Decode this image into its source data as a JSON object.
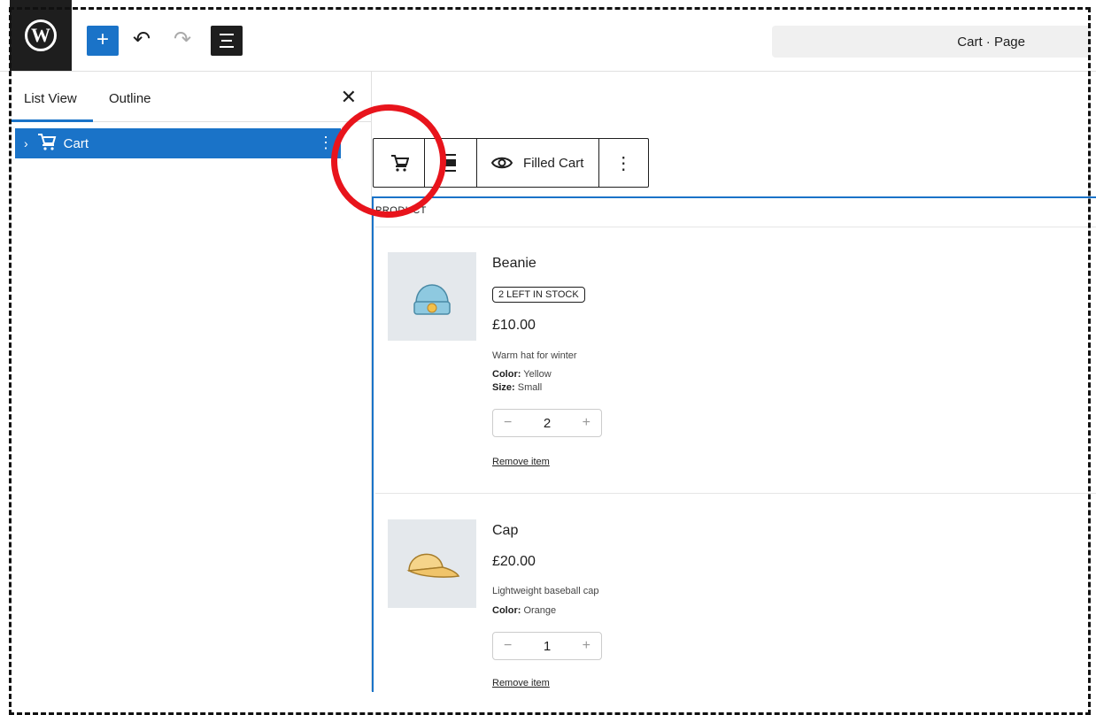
{
  "header": {
    "logo_letter": "W",
    "add_symbol": "+",
    "undo_symbol": "↶",
    "redo_symbol": "↷",
    "command_bar_text": "Cart · Page"
  },
  "sidebar": {
    "tabs": [
      {
        "label": "List View"
      },
      {
        "label": "Outline"
      }
    ],
    "close_symbol": "✕",
    "items": [
      {
        "label": "Cart",
        "chevron": "›",
        "icon": "cart-icon",
        "more": "⋮"
      }
    ]
  },
  "block_toolbar": {
    "view_label": "Filled Cart",
    "more": "⋮"
  },
  "cart": {
    "products_heading": "PRODUCT",
    "items": [
      {
        "name": "Beanie",
        "badge": "2 LEFT IN STOCK",
        "price": "£10.00",
        "description": "Warm hat for winter",
        "attrs": [
          {
            "key": "Color:",
            "value": " Yellow"
          },
          {
            "key": "Size:",
            "value": " Small"
          }
        ],
        "minus": "−",
        "quantity": "2",
        "plus": "+",
        "remove_label": "Remove item",
        "image": "beanie-image"
      },
      {
        "name": "Cap",
        "price": "£20.00",
        "description": "Lightweight baseball cap",
        "attrs": [
          {
            "key": "Color:",
            "value": " Orange"
          }
        ],
        "minus": "−",
        "quantity": "1",
        "plus": "+",
        "remove_label": "Remove item",
        "image": "cap-image"
      }
    ]
  },
  "colors": {
    "accent": "#1a73c8",
    "dark": "#1e1e1e",
    "highlight": "#e8141c"
  }
}
